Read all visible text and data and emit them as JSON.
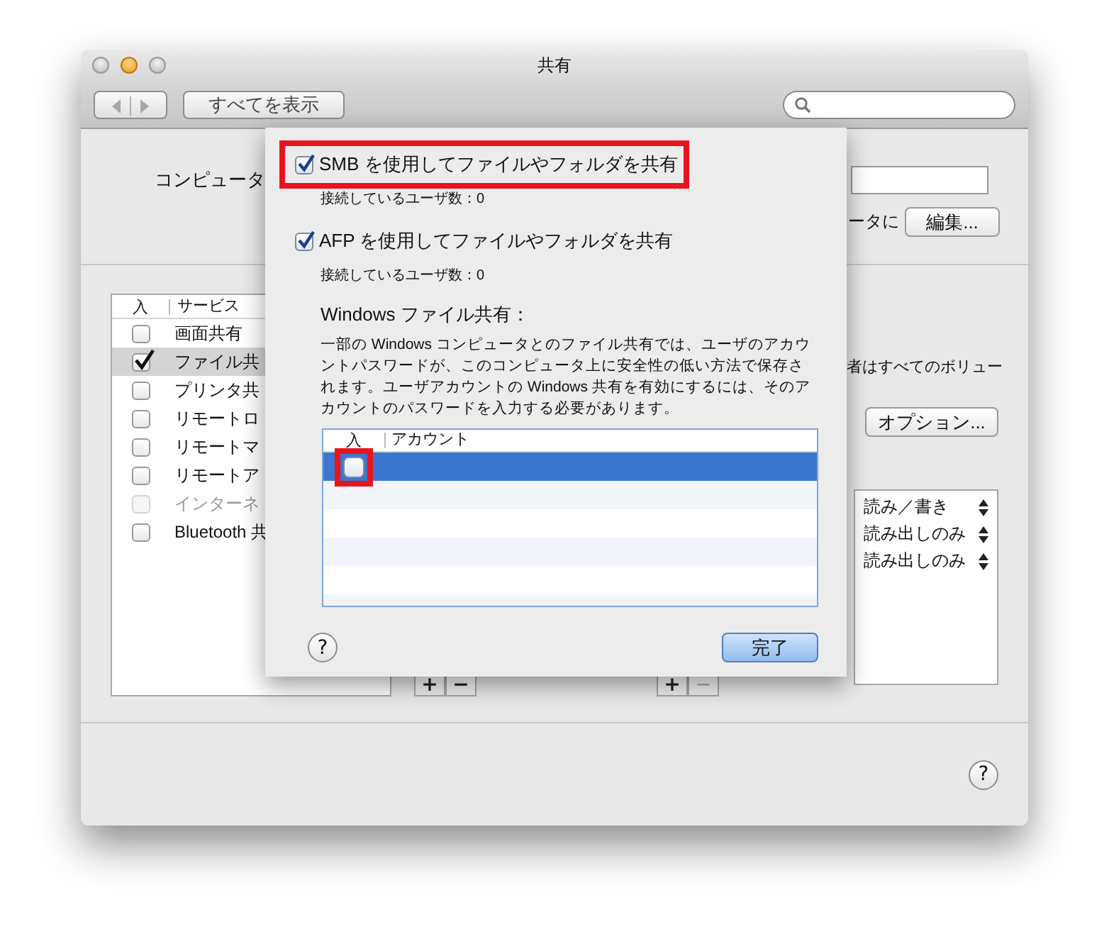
{
  "window": {
    "title": "共有"
  },
  "toolbar": {
    "show_all_button": "すべてを表示"
  },
  "computer_name": {
    "label": "コンピュータ",
    "address_text": "ータに",
    "edit_button": "編集..."
  },
  "services": {
    "columns": [
      "入",
      "サービス"
    ],
    "items": [
      {
        "name": "画面共有",
        "checked": false,
        "selected": false,
        "disabled": false
      },
      {
        "name": "ファイル共",
        "checked": true,
        "selected": true,
        "disabled": false
      },
      {
        "name": "プリンタ共",
        "checked": false,
        "selected": false,
        "disabled": false
      },
      {
        "name": "リモートロ",
        "checked": false,
        "selected": false,
        "disabled": false
      },
      {
        "name": "リモートマ",
        "checked": false,
        "selected": false,
        "disabled": false
      },
      {
        "name": "リモートア",
        "checked": false,
        "selected": false,
        "disabled": false
      },
      {
        "name": "インターネ",
        "checked": false,
        "selected": false,
        "disabled": true
      },
      {
        "name": "Bluetooth 共",
        "checked": false,
        "selected": false,
        "disabled": false
      }
    ]
  },
  "add_remove": [
    {
      "add": "+",
      "remove": "−",
      "remove_disabled": false
    },
    {
      "add": "+",
      "remove": "−",
      "remove_disabled": true
    }
  ],
  "options_note": "者はすべてのボリュー",
  "options_button": "オプション...",
  "permissions": [
    "読み／書き",
    "読み出しのみ",
    "読み出しのみ"
  ],
  "help_button": "?",
  "sheet": {
    "protocols": [
      {
        "label": "SMB を使用してファイルやフォルダを共有",
        "checked": true,
        "highlighted": true,
        "users": "接続しているユーザ数：0"
      },
      {
        "label": "AFP を使用してファイルやフォルダを共有",
        "checked": true,
        "highlighted": false,
        "users": "接続しているユーザ数：0"
      }
    ],
    "windows_heading": "Windows ファイル共有：",
    "windows_note": "一部の Windows コンピュータとのファイル共有では、ユーザのアカウントパスワードが、このコンピュータ上に安全性の低い方法で保存されます。ユーザアカウントの Windows 共有を有効にするには、そのアカウントのパスワードを入力する必要があります。",
    "accounts": {
      "columns": [
        "入",
        "アカウント"
      ],
      "rows": [
        {
          "checked": false,
          "selected": true,
          "highlighted": true
        }
      ]
    },
    "help_button": "?",
    "done_button": "完了"
  }
}
